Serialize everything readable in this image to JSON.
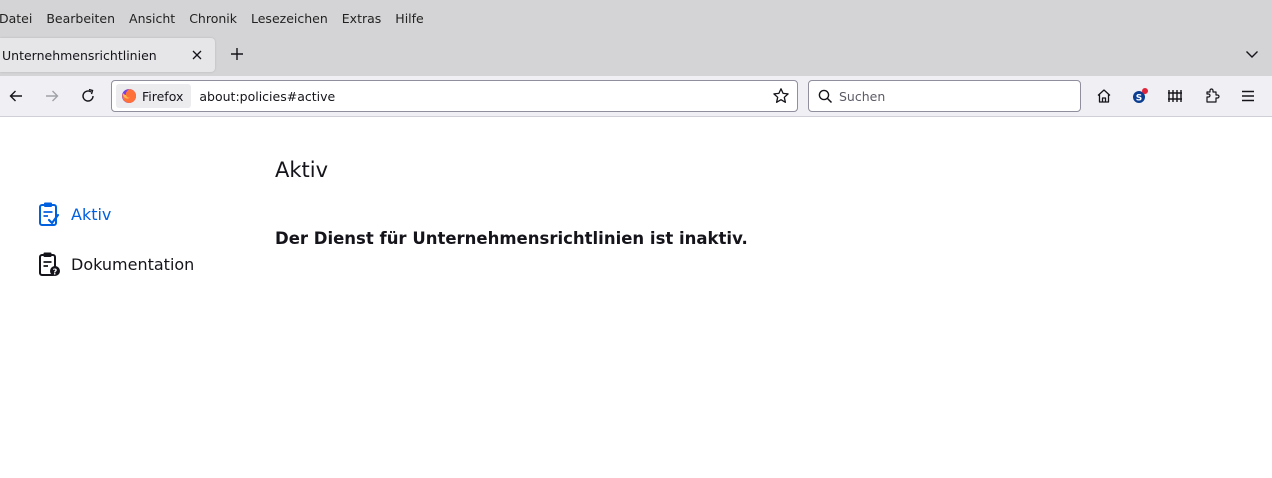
{
  "menubar": {
    "items": [
      "Datei",
      "Bearbeiten",
      "Ansicht",
      "Chronik",
      "Lesezeichen",
      "Extras",
      "Hilfe"
    ]
  },
  "tabs": [
    {
      "title": "Unternehmensrichtlinien",
      "active": true
    }
  ],
  "navbar": {
    "identity_label": "Firefox",
    "url": "about:policies#active",
    "search_placeholder": "Suchen"
  },
  "sidebar": {
    "items": [
      {
        "label": "Aktiv",
        "icon": "clipboard-check-icon",
        "selected": true
      },
      {
        "label": "Dokumentation",
        "icon": "clipboard-question-icon",
        "selected": false
      }
    ]
  },
  "main": {
    "title": "Aktiv",
    "message": "Der Dienst für Unternehmensrichtlinien ist inaktiv."
  },
  "colors": {
    "accent": "#0061e0",
    "chrome_bg": "#d4d4d6",
    "toolbar_bg": "#f0f0f4"
  }
}
